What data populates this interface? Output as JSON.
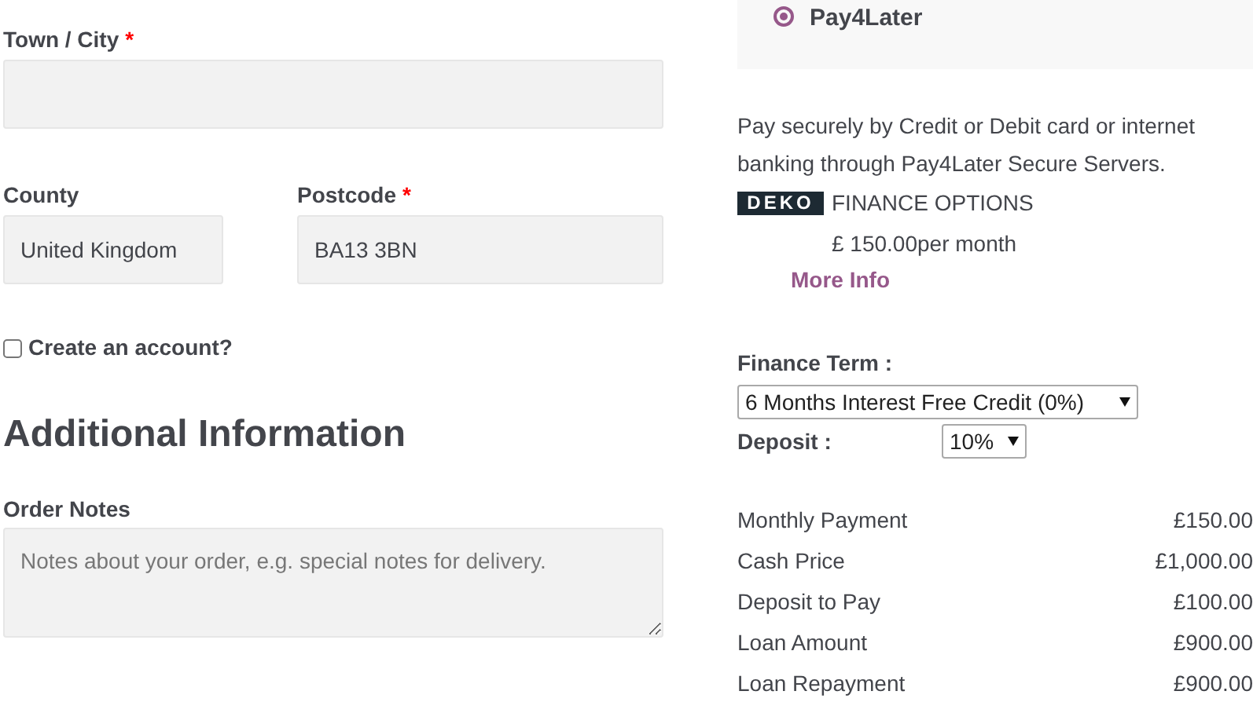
{
  "billing_fields": [
    {
      "label": "Town / City",
      "required_mark": "*"
    },
    {
      "label": "County",
      "value": "United Kingdom"
    },
    {
      "label": "Postcode",
      "required_mark": "*",
      "value": "BA13 3BN"
    }
  ],
  "create_account": {
    "label": "Create an account?",
    "checked": false
  },
  "additional_information": {
    "heading": "Additional Information",
    "order_notes": {
      "label": "Order Notes",
      "placeholder": "Notes about your order, e.g. special notes for delivery."
    }
  },
  "payment_method": {
    "label": "Pay4Later",
    "selected": true
  },
  "description": "Pay securely by Credit or Debit card or internet banking through Pay4Later Secure Servers.",
  "finance": {
    "logo": "DEKO",
    "title": "FINANCE OPTIONS",
    "per_month": "£ 150.00per month",
    "more_info": "More Info"
  },
  "finance_term": {
    "label": "Finance Term :",
    "value": "6 Months Interest Free Credit (0%)"
  },
  "deposit": {
    "label": "Deposit :",
    "value": "10%"
  },
  "summary": [
    {
      "label": "Monthly Payment",
      "value": "£150.00"
    },
    {
      "label": "Cash Price",
      "value": "£1,000.00"
    },
    {
      "label": "Deposit to Pay",
      "value": "£100.00"
    },
    {
      "label": "Loan Amount",
      "value": "£900.00"
    },
    {
      "label": "Loan Repayment",
      "value": "£900.00"
    }
  ]
}
